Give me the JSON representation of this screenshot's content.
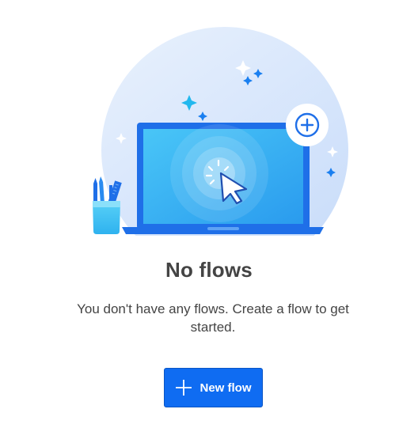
{
  "empty_state": {
    "title": "No flows",
    "description": "You don't have any flows. Create a flow to get started.",
    "illustration": {
      "icons": [
        "laptop-icon",
        "cursor-click-icon",
        "add-circle-icon",
        "pencil-cup-icon",
        "sparkle-icon"
      ]
    }
  },
  "actions": {
    "new_flow_label": "New flow",
    "new_flow_icon": "plus-icon"
  },
  "colors": {
    "accent": "#0f6cf2",
    "title_text": "#444444",
    "background_circle": "#dce9fb"
  }
}
